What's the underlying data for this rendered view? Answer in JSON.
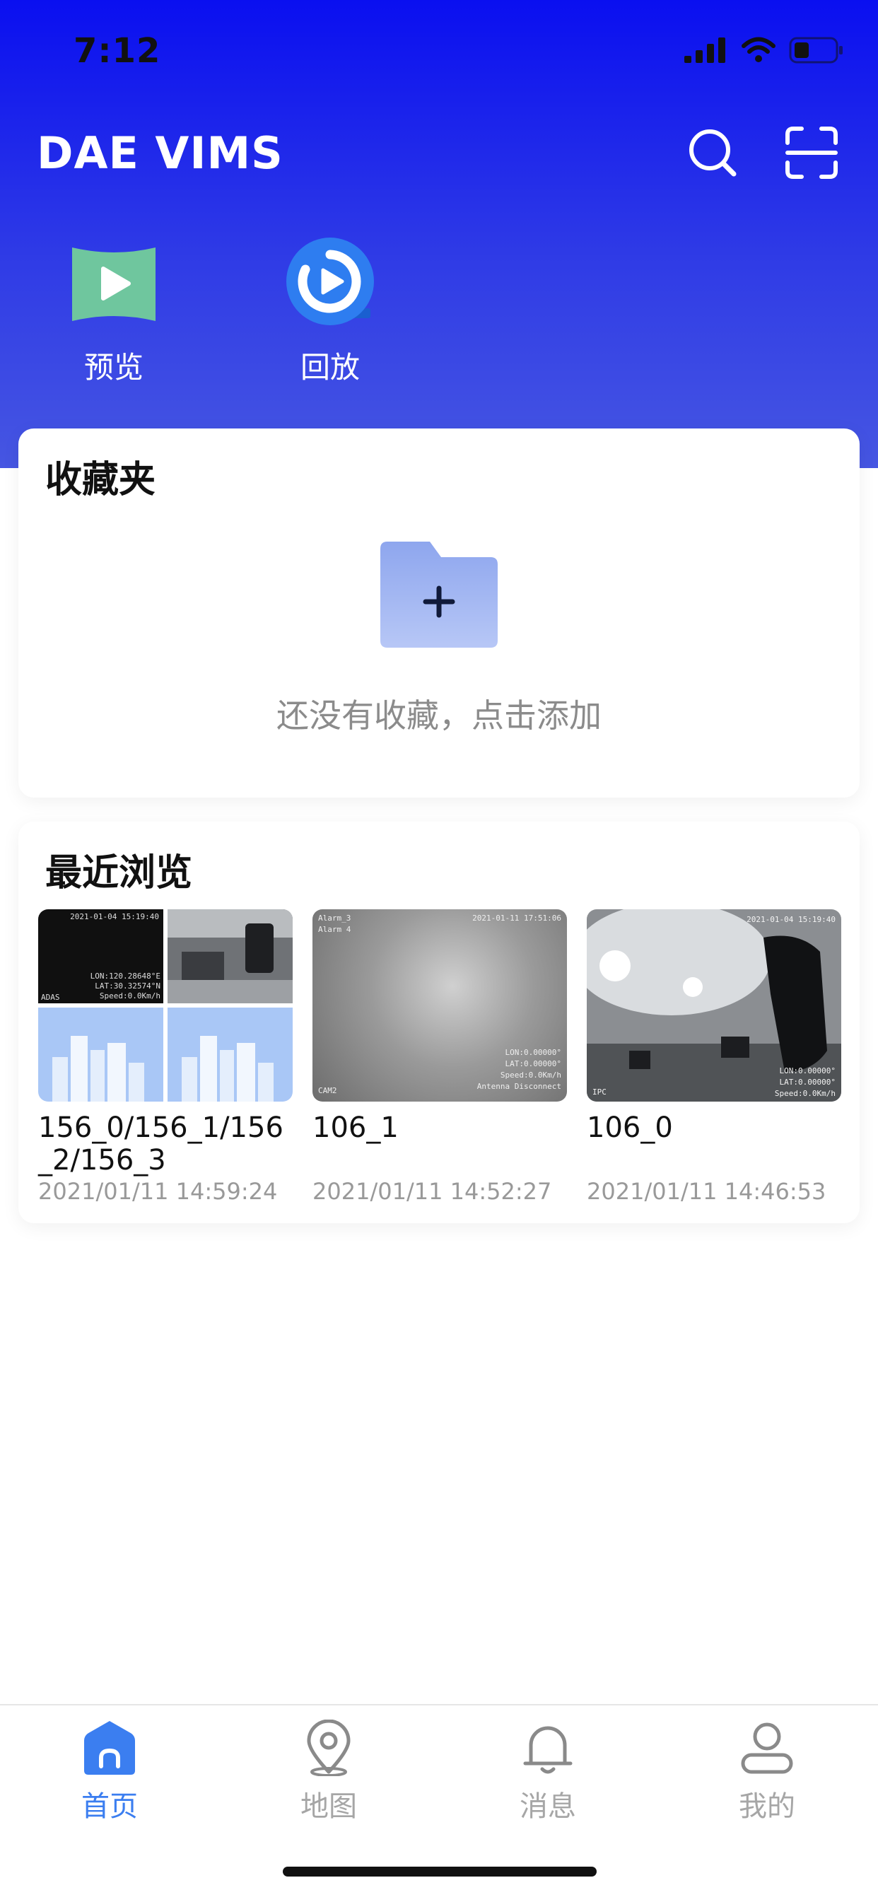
{
  "status": {
    "time": "7:12"
  },
  "header": {
    "title": "DAE VIMS",
    "search_icon": "search-icon",
    "scan_icon": "scan-icon",
    "quick_actions": [
      {
        "label": "预览",
        "icon": "preview-play-icon",
        "color": "#6fc69e"
      },
      {
        "label": "回放",
        "icon": "playback-icon",
        "color": "#2e7df0"
      }
    ]
  },
  "favorites": {
    "title": "收藏夹",
    "empty_text": "还没有收藏，点击添加",
    "folder_icon": "add-folder-icon"
  },
  "recent": {
    "title": "最近浏览",
    "items": [
      {
        "name": "156_0/156_1/156_2/156_3",
        "time": "2021/01/11 14:59:24",
        "overlay": {
          "tl": "ADAS",
          "tr": "2021-01-04 15:19:40",
          "lon": "LON:120.28648°E",
          "lat": "LAT:30.32574°N",
          "speed": "Speed:0.0Km/h"
        }
      },
      {
        "name": "106_1",
        "time": "2021/01/11 14:52:27",
        "overlay": {
          "tl1": "Alarm_3",
          "tl2": "Alarm 4",
          "tr": "2021-01-11 17:51:06",
          "lon": "LON:0.00000°",
          "lat": "LAT:0.00000°",
          "speed": "Speed:0.0Km/h",
          "antenna": "Antenna Disconnect",
          "bl": "CAM2"
        }
      },
      {
        "name": "106_0",
        "time": "2021/01/11 14:46:53",
        "overlay": {
          "tr": "2021-01-04 15:19:40",
          "lon": "LON:0.00000°",
          "lat": "LAT:0.00000°",
          "speed": "Speed:0.0Km/h",
          "bl": "IPC"
        }
      }
    ]
  },
  "tabs": [
    {
      "label": "首页",
      "icon": "home-icon",
      "active": true
    },
    {
      "label": "地图",
      "icon": "map-pin-icon",
      "active": false
    },
    {
      "label": "消息",
      "icon": "bell-icon",
      "active": false
    },
    {
      "label": "我的",
      "icon": "profile-icon",
      "active": false
    }
  ],
  "colors": {
    "header_top": "#0a0ff0",
    "header_bottom": "#4656e2",
    "accent": "#3b7ef0",
    "muted": "#a6a6a6"
  }
}
